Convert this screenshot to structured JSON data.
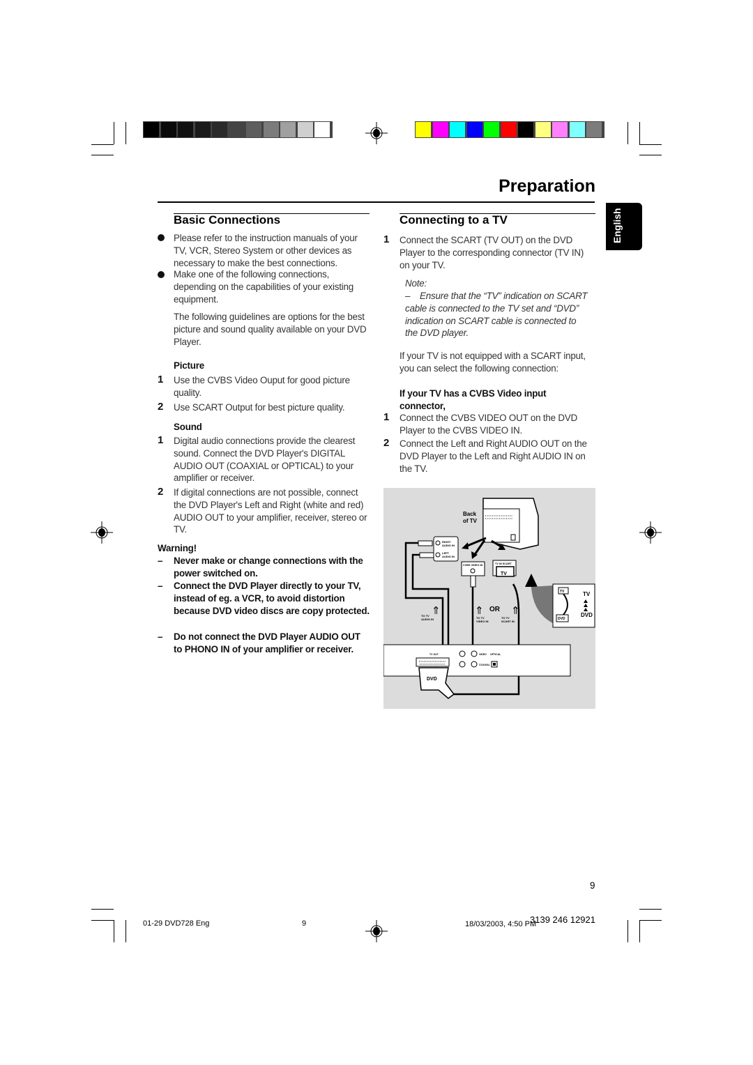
{
  "header": {
    "title": "Preparation",
    "language_tab": "English"
  },
  "color_bars": {
    "grays": [
      "#000000",
      "#0a0a0a",
      "#111111",
      "#1a1a1a",
      "#2a2a2a",
      "#444444",
      "#5e5e5e",
      "#7c7c7c",
      "#a0a0a0",
      "#cfcfcf",
      "#ffffff"
    ],
    "colors": [
      "#ffff00",
      "#ff00ff",
      "#00ffff",
      "#0000ff",
      "#00ff00",
      "#ff0000",
      "#000000",
      "#ffff80",
      "#ff80ff",
      "#80ffff",
      "#7c7c7c"
    ]
  },
  "left": {
    "heading": "Basic Connections",
    "bullets": [
      "Please refer to the instruction manuals of your TV, VCR, Stereo System or other devices as necessary to make the best connections.",
      "Make one of the following connections, depending on the capabilities of your existing equipment."
    ],
    "intro": "The following guidelines are options for the best picture and sound quality available on your DVD Player.",
    "picture": {
      "heading": "Picture",
      "items": [
        {
          "n": "1",
          "text": "Use the CVBS Video Ouput for good picture quality."
        },
        {
          "n": "2",
          "text": "Use SCART Output for best picture quality."
        }
      ]
    },
    "sound": {
      "heading": "Sound",
      "items": [
        {
          "n": "1",
          "text": "Digital audio connections provide the clearest sound. Connect the DVD Player's DIGITAL AUDIO OUT (COAXIAL or OPTICAL) to your amplifier or receiver."
        },
        {
          "n": "2",
          "text": "If digital connections are not possible, connect the DVD Player's Left and Right (white and red) AUDIO OUT to your amplifier, receiver, stereo or TV."
        }
      ]
    },
    "warning": {
      "heading": "Warning!",
      "items": [
        "Never make or change connections with the power switched on.",
        "Connect the DVD Player directly to your TV, instead of eg. a VCR,  to avoid distortion because DVD video discs are copy protected.",
        "Do not connect the DVD Player AUDIO OUT to PHONO IN of your amplifier or receiver."
      ]
    }
  },
  "right": {
    "heading": "Connecting to a TV",
    "step1": {
      "n": "1",
      "text": "Connect the SCART (TV OUT) on the DVD Player to the corresponding connector (TV IN) on your TV."
    },
    "note": {
      "label": "Note:",
      "dash": "–",
      "text": "Ensure that the “TV” indication on SCART cable is connected to the TV set and “DVD” indication on SCART cable is connected to the DVD player."
    },
    "alt": "If your TV is not equipped with a SCART input, you can select the following connection:",
    "cvbs": {
      "heading": "If your TV has a CVBS Video input connector,",
      "items": [
        {
          "n": "1",
          "text": "Connect the CVBS VIDEO OUT on the DVD Player to the CVBS VIDEO IN."
        },
        {
          "n": "2",
          "text": "Connect the Left and Right AUDIO OUT on the DVD Player to the Left and Right AUDIO IN on the TV."
        }
      ]
    }
  },
  "diagram": {
    "back_of_tv": [
      "Back",
      "of TV"
    ],
    "right_audio": [
      "RIGHT",
      "AUDIO IN"
    ],
    "left_audio": [
      "LEFT",
      "AUDIO IN"
    ],
    "cvbs_in": "CVBS VIDEO IN",
    "scart_in": "TV IN SCART",
    "tv_plug": "TV",
    "or": "OR",
    "to_audio": [
      "TO TV",
      "AUDIO IN"
    ],
    "to_video": [
      "TO TV",
      "VIDEO IN"
    ],
    "to_scart": [
      "TO TV",
      "SCART IN"
    ],
    "tv_out": "TV OUT",
    "video": "VIDEO",
    "optical": "OPTICAL",
    "coaxial": "COAXIAL",
    "dvd_plug": "DVD",
    "inset_tv": "TV",
    "inset_dvd": "DVD"
  },
  "footer": {
    "page_number": "9",
    "file": "01-29 DVD728 Eng",
    "file_page": "9",
    "date": "18/03/2003, 4:50 PM",
    "code": "3139 246 12921"
  }
}
